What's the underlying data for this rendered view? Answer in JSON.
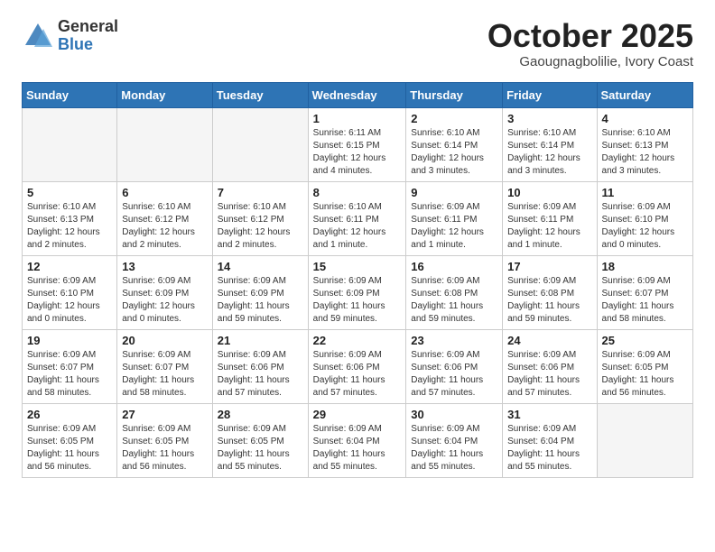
{
  "header": {
    "logo_general": "General",
    "logo_blue": "Blue",
    "month_title": "October 2025",
    "subtitle": "Gaougnagbolilie, Ivory Coast"
  },
  "days_of_week": [
    "Sunday",
    "Monday",
    "Tuesday",
    "Wednesday",
    "Thursday",
    "Friday",
    "Saturday"
  ],
  "weeks": [
    [
      {
        "day": "",
        "info": ""
      },
      {
        "day": "",
        "info": ""
      },
      {
        "day": "",
        "info": ""
      },
      {
        "day": "1",
        "info": "Sunrise: 6:11 AM\nSunset: 6:15 PM\nDaylight: 12 hours\nand 4 minutes."
      },
      {
        "day": "2",
        "info": "Sunrise: 6:10 AM\nSunset: 6:14 PM\nDaylight: 12 hours\nand 3 minutes."
      },
      {
        "day": "3",
        "info": "Sunrise: 6:10 AM\nSunset: 6:14 PM\nDaylight: 12 hours\nand 3 minutes."
      },
      {
        "day": "4",
        "info": "Sunrise: 6:10 AM\nSunset: 6:13 PM\nDaylight: 12 hours\nand 3 minutes."
      }
    ],
    [
      {
        "day": "5",
        "info": "Sunrise: 6:10 AM\nSunset: 6:13 PM\nDaylight: 12 hours\nand 2 minutes."
      },
      {
        "day": "6",
        "info": "Sunrise: 6:10 AM\nSunset: 6:12 PM\nDaylight: 12 hours\nand 2 minutes."
      },
      {
        "day": "7",
        "info": "Sunrise: 6:10 AM\nSunset: 6:12 PM\nDaylight: 12 hours\nand 2 minutes."
      },
      {
        "day": "8",
        "info": "Sunrise: 6:10 AM\nSunset: 6:11 PM\nDaylight: 12 hours\nand 1 minute."
      },
      {
        "day": "9",
        "info": "Sunrise: 6:09 AM\nSunset: 6:11 PM\nDaylight: 12 hours\nand 1 minute."
      },
      {
        "day": "10",
        "info": "Sunrise: 6:09 AM\nSunset: 6:11 PM\nDaylight: 12 hours\nand 1 minute."
      },
      {
        "day": "11",
        "info": "Sunrise: 6:09 AM\nSunset: 6:10 PM\nDaylight: 12 hours\nand 0 minutes."
      }
    ],
    [
      {
        "day": "12",
        "info": "Sunrise: 6:09 AM\nSunset: 6:10 PM\nDaylight: 12 hours\nand 0 minutes."
      },
      {
        "day": "13",
        "info": "Sunrise: 6:09 AM\nSunset: 6:09 PM\nDaylight: 12 hours\nand 0 minutes."
      },
      {
        "day": "14",
        "info": "Sunrise: 6:09 AM\nSunset: 6:09 PM\nDaylight: 11 hours\nand 59 minutes."
      },
      {
        "day": "15",
        "info": "Sunrise: 6:09 AM\nSunset: 6:09 PM\nDaylight: 11 hours\nand 59 minutes."
      },
      {
        "day": "16",
        "info": "Sunrise: 6:09 AM\nSunset: 6:08 PM\nDaylight: 11 hours\nand 59 minutes."
      },
      {
        "day": "17",
        "info": "Sunrise: 6:09 AM\nSunset: 6:08 PM\nDaylight: 11 hours\nand 59 minutes."
      },
      {
        "day": "18",
        "info": "Sunrise: 6:09 AM\nSunset: 6:07 PM\nDaylight: 11 hours\nand 58 minutes."
      }
    ],
    [
      {
        "day": "19",
        "info": "Sunrise: 6:09 AM\nSunset: 6:07 PM\nDaylight: 11 hours\nand 58 minutes."
      },
      {
        "day": "20",
        "info": "Sunrise: 6:09 AM\nSunset: 6:07 PM\nDaylight: 11 hours\nand 58 minutes."
      },
      {
        "day": "21",
        "info": "Sunrise: 6:09 AM\nSunset: 6:06 PM\nDaylight: 11 hours\nand 57 minutes."
      },
      {
        "day": "22",
        "info": "Sunrise: 6:09 AM\nSunset: 6:06 PM\nDaylight: 11 hours\nand 57 minutes."
      },
      {
        "day": "23",
        "info": "Sunrise: 6:09 AM\nSunset: 6:06 PM\nDaylight: 11 hours\nand 57 minutes."
      },
      {
        "day": "24",
        "info": "Sunrise: 6:09 AM\nSunset: 6:06 PM\nDaylight: 11 hours\nand 57 minutes."
      },
      {
        "day": "25",
        "info": "Sunrise: 6:09 AM\nSunset: 6:05 PM\nDaylight: 11 hours\nand 56 minutes."
      }
    ],
    [
      {
        "day": "26",
        "info": "Sunrise: 6:09 AM\nSunset: 6:05 PM\nDaylight: 11 hours\nand 56 minutes."
      },
      {
        "day": "27",
        "info": "Sunrise: 6:09 AM\nSunset: 6:05 PM\nDaylight: 11 hours\nand 56 minutes."
      },
      {
        "day": "28",
        "info": "Sunrise: 6:09 AM\nSunset: 6:05 PM\nDaylight: 11 hours\nand 55 minutes."
      },
      {
        "day": "29",
        "info": "Sunrise: 6:09 AM\nSunset: 6:04 PM\nDaylight: 11 hours\nand 55 minutes."
      },
      {
        "day": "30",
        "info": "Sunrise: 6:09 AM\nSunset: 6:04 PM\nDaylight: 11 hours\nand 55 minutes."
      },
      {
        "day": "31",
        "info": "Sunrise: 6:09 AM\nSunset: 6:04 PM\nDaylight: 11 hours\nand 55 minutes."
      },
      {
        "day": "",
        "info": ""
      }
    ]
  ]
}
